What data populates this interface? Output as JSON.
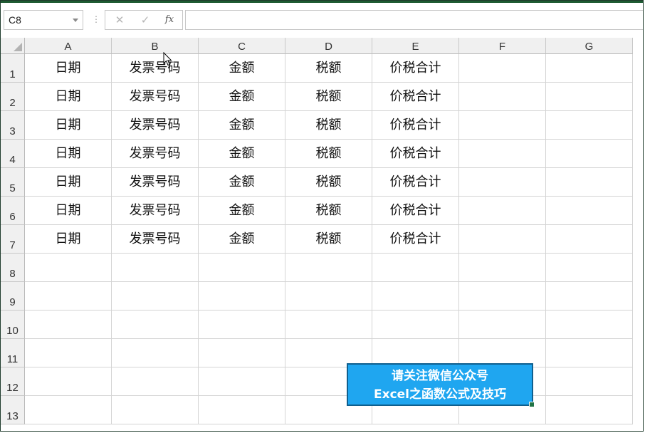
{
  "formula_bar": {
    "name_box_value": "C8",
    "separator": "⋮",
    "cancel_glyph": "✕",
    "enter_glyph": "✓",
    "fx_label": "fx",
    "formula_value": ""
  },
  "columns": [
    "A",
    "B",
    "C",
    "D",
    "E",
    "F",
    "G"
  ],
  "rows": [
    "1",
    "2",
    "3",
    "4",
    "5",
    "6",
    "7",
    "8",
    "9",
    "10",
    "11",
    "12",
    "13"
  ],
  "table_rows": [
    [
      "日期",
      "发票号码",
      "金额",
      "税额",
      "价税合计"
    ],
    [
      "日期",
      "发票号码",
      "金额",
      "税额",
      "价税合计"
    ],
    [
      "日期",
      "发票号码",
      "金额",
      "税额",
      "价税合计"
    ],
    [
      "日期",
      "发票号码",
      "金额",
      "税额",
      "价税合计"
    ],
    [
      "日期",
      "发票号码",
      "金额",
      "税额",
      "价税合计"
    ],
    [
      "日期",
      "发票号码",
      "金额",
      "税额",
      "价税合计"
    ],
    [
      "日期",
      "发票号码",
      "金额",
      "税额",
      "价税合计"
    ]
  ],
  "selected_cell": "C8",
  "banner": {
    "line1": "请关注微信公众号",
    "line2": "Excel之函数公式及技巧"
  },
  "colors": {
    "accent": "#217346",
    "banner_bg": "#1fa6f0",
    "header_bg": "#f0f0f0"
  }
}
